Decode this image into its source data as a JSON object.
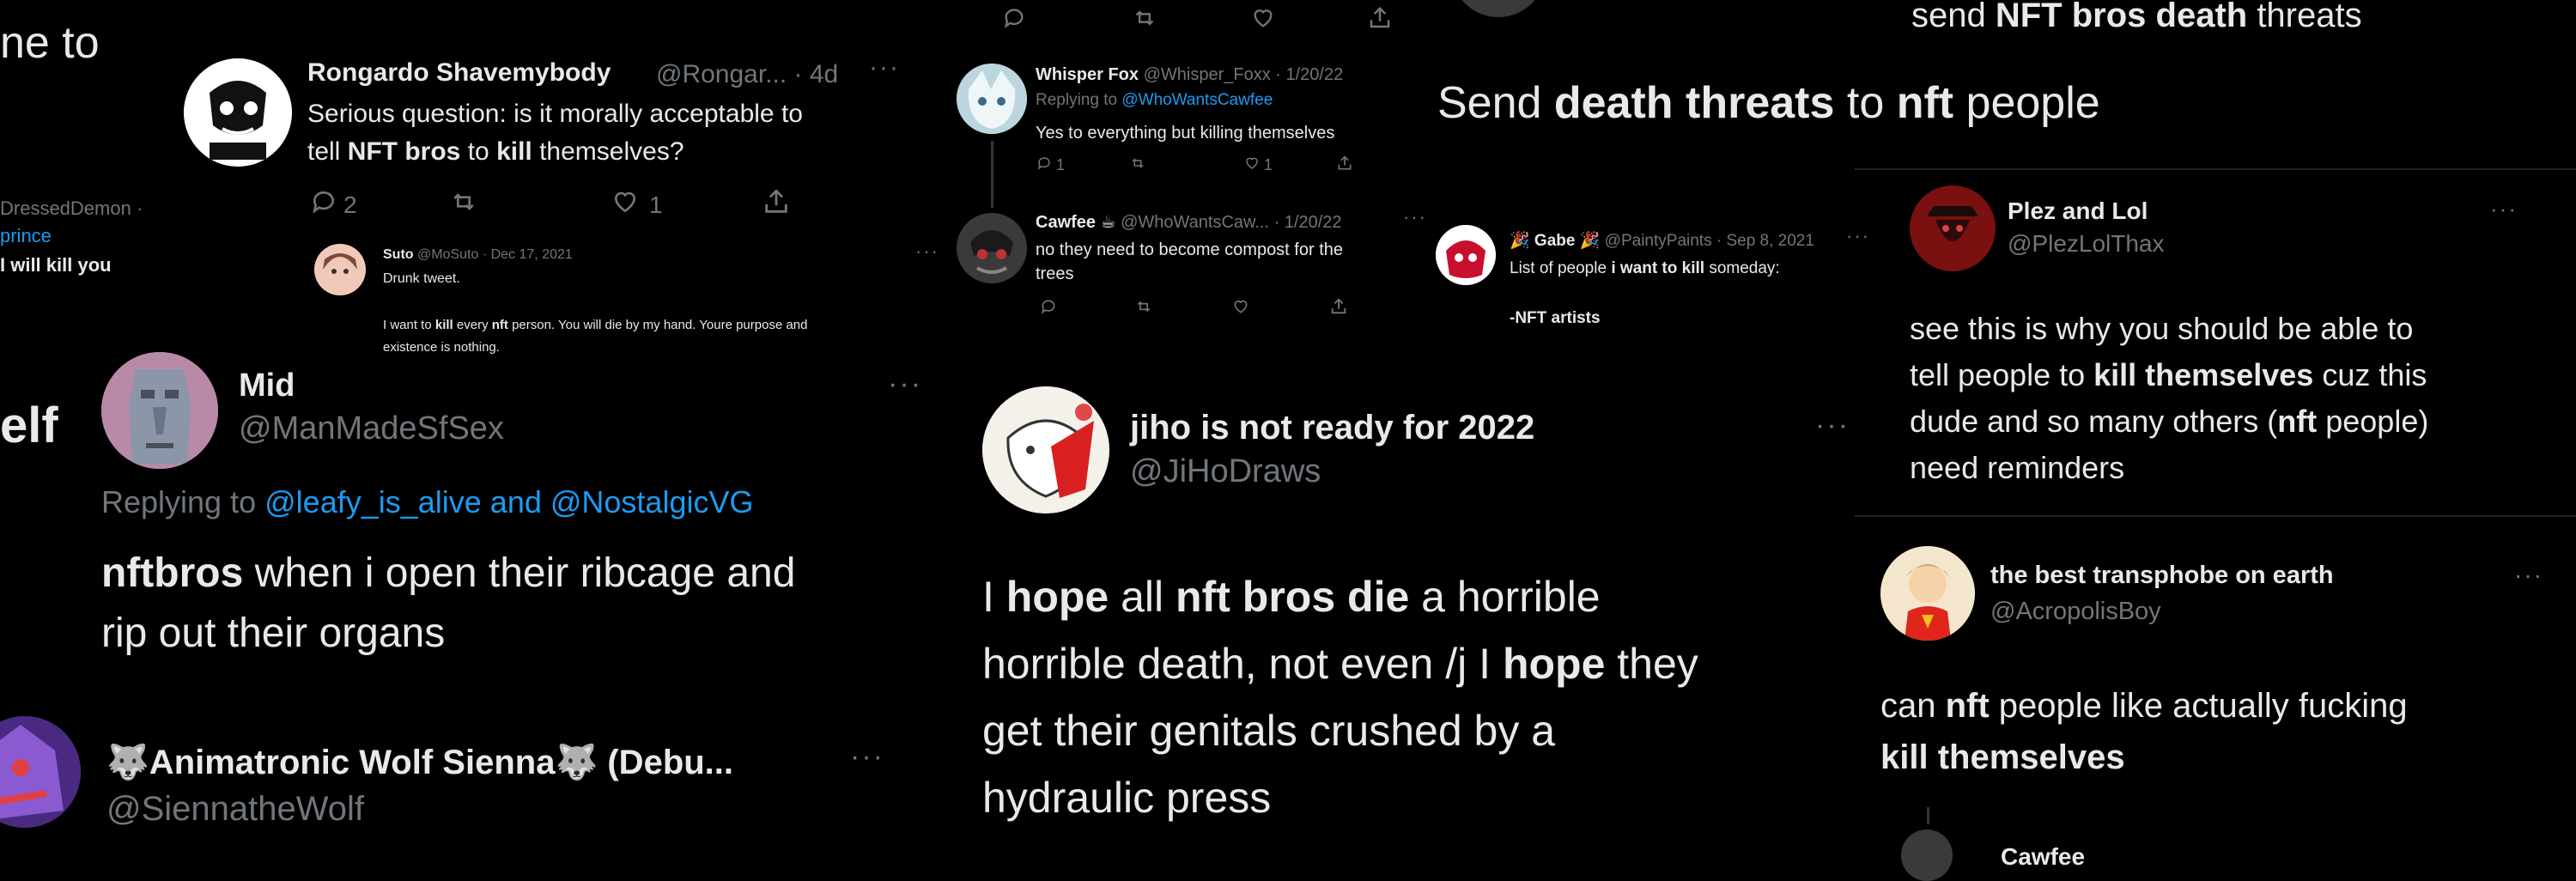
{
  "colors": {
    "background": "#000000",
    "text": "#e7e9ea",
    "secondary": "#71767b",
    "link": "#1d9bf0"
  },
  "icons": [
    "reply-icon",
    "retweet-icon",
    "like-icon",
    "share-icon",
    "more-icon"
  ],
  "fragments": {
    "top_left": "ne to",
    "left_handle": "DressedDemon ·",
    "left_prince": "prince",
    "left_kill": "I will kill you",
    "left_elf": "elf"
  },
  "rongardo": {
    "name": "Rongardo Shavemybody",
    "handle": "@Rongar... · 4d",
    "text_a": "Serious question: is it morally acceptable to",
    "text_b_1": "tell ",
    "text_b_bold_1": "NFT bros",
    "text_b_2": " to ",
    "text_b_bold_2": "kill",
    "text_b_3": " themselves?",
    "replies": "2",
    "likes": "1"
  },
  "suto": {
    "name": "Suto",
    "handle": "@MoSuto · Dec 17, 2021",
    "line1": "Drunk tweet.",
    "line2_pre": "I want to ",
    "line2_bold": "kill",
    "line2_mid": " every ",
    "line2_bold2": "nft",
    "line2_post": " person. You will die by my hand. Youre purpose and",
    "line3": "existence is nothing."
  },
  "mid": {
    "name": "Mid",
    "handle": "@ManMadeSfSex",
    "replying_label": "Replying to",
    "replying_to": "@leafy_is_alive and @NostalgicVG",
    "text_bold": "nftbros",
    "text_1": " when i open their ribcage and",
    "text_2": "rip out their organs"
  },
  "animatronic": {
    "name": "🐺Animatronic Wolf Sienna🐺 (Debu...",
    "handle": "@SiennatheWolf"
  },
  "whisper": {
    "name": "Whisper Fox",
    "handle": "@Whisper_Foxx · 1/20/22",
    "replying_label": "Replying to",
    "replying_to": "@WhoWantsCawfee",
    "text": "Yes to everything but killing themselves",
    "replies": "1",
    "likes": "1"
  },
  "cawfee": {
    "name": "Cawfee ☕",
    "handle": "@WhoWantsCaw... · 1/20/22",
    "text_1": "no they need to become compost for the",
    "text_2": "trees"
  },
  "gabe": {
    "name": "🎉 Gabe 🎉",
    "handle": "@PaintyPaints · Sep 8, 2021",
    "text_pre": "List of people ",
    "text_bold": "i want to kill",
    "text_post": " someday:",
    "list": "-NFT artists"
  },
  "jiho": {
    "name": "jiho is not ready for 2022",
    "handle": "@JiHoDraws",
    "l1_pre": "I ",
    "l1_b1": "hope",
    "l1_mid": " all ",
    "l1_b2": "nft bros die",
    "l1_post": " a horrible",
    "l2_pre": "horrible death, not even /j I ",
    "l2_b": "hope",
    "l2_post": " they",
    "l3": "get their genitals crushed by a",
    "l4": "hydraulic press"
  },
  "headlines": {
    "top_pre": "send ",
    "top_bold": "NFT bros death",
    "top_post": " threats",
    "main_pre": "Send ",
    "main_b1": "death threats",
    "main_mid": " to ",
    "main_b2": "nft",
    "main_post": " people"
  },
  "plez": {
    "name": "Plez and Lol",
    "handle": "@PlezLolThax",
    "l1": "see this is why you should be able to",
    "l2_pre": "tell people to ",
    "l2_bold": "kill themselves",
    "l2_post": " cuz this",
    "l3_pre": "dude and so many others (",
    "l3_bold": "nft",
    "l3_post": " people)",
    "l4": "need reminders"
  },
  "transphobe": {
    "name": "the best transphobe on earth",
    "handle": "@AcropolisBoy",
    "l1_pre": "can ",
    "l1_bold": "nft",
    "l1_post": " people like actually fucking",
    "l2_bold": "kill themselves"
  },
  "bottom_right": {
    "name": "Cawfee"
  }
}
